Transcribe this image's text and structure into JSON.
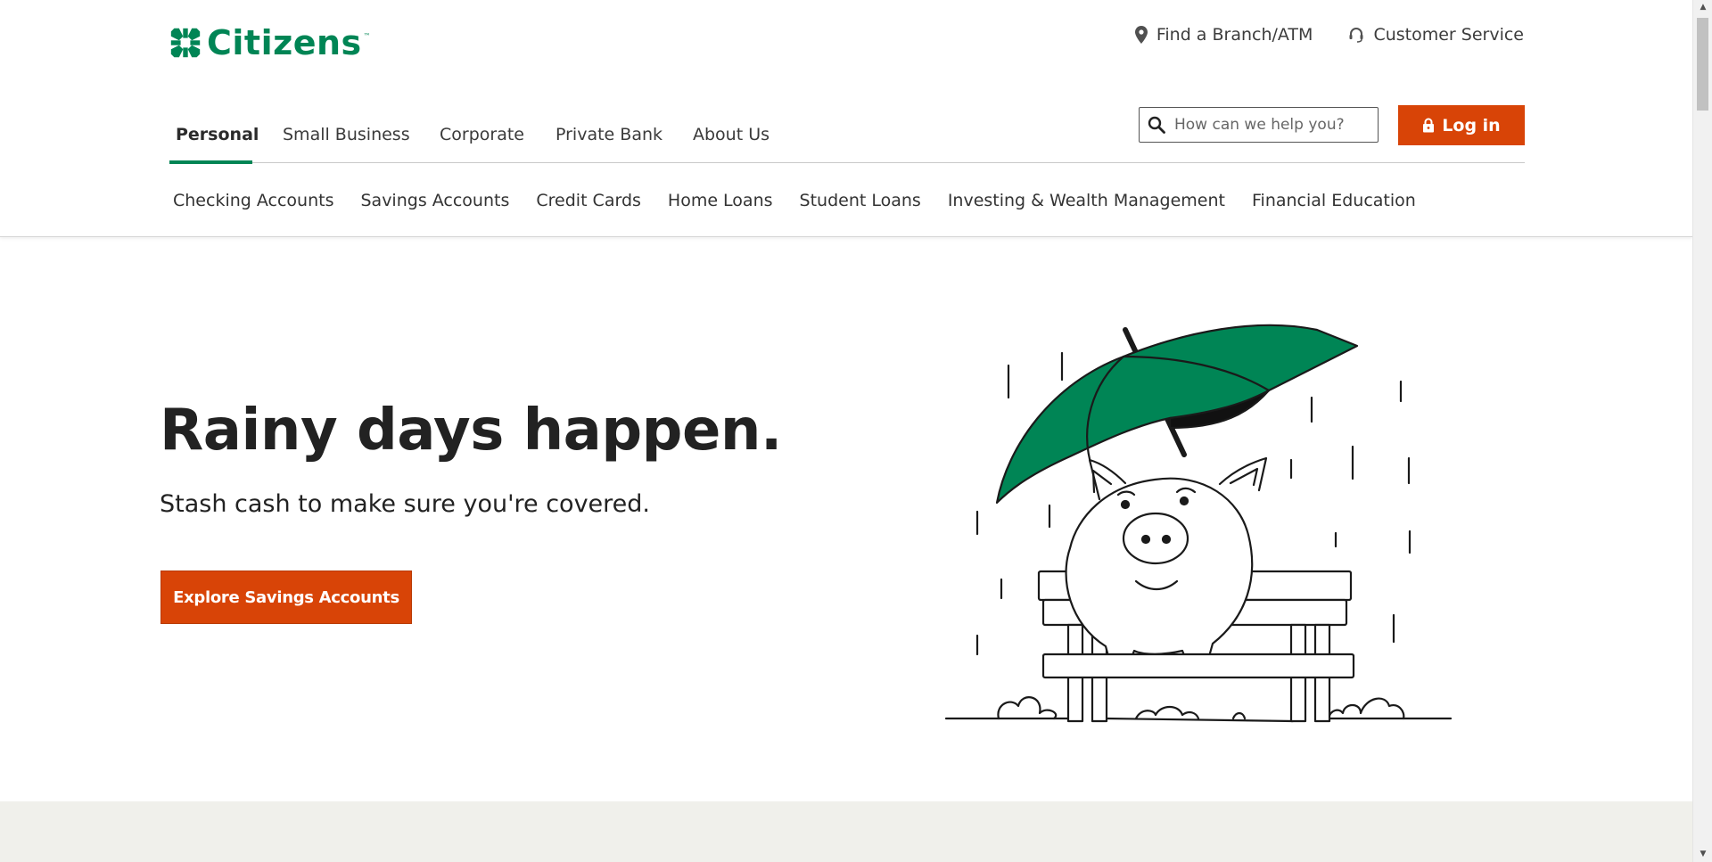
{
  "brand": {
    "name": "Citizens",
    "trademark": "™",
    "primary_color": "#008555",
    "accent_color": "#d84407"
  },
  "utility_nav": {
    "branch": {
      "label": "Find a Branch/ATM",
      "icon": "location-pin-icon"
    },
    "service": {
      "label": "Customer Service",
      "icon": "headset-icon"
    }
  },
  "main_nav": {
    "active": "Personal",
    "items": [
      "Personal",
      "Small Business",
      "Corporate",
      "Private Bank",
      "About Us"
    ]
  },
  "search": {
    "placeholder": "How can we help you?",
    "value": "",
    "icon": "search-icon"
  },
  "login": {
    "label": "Log in",
    "icon": "lock-icon"
  },
  "sub_nav": {
    "items": [
      "Checking Accounts",
      "Savings Accounts",
      "Credit Cards",
      "Home Loans",
      "Student Loans",
      "Investing & Wealth Management",
      "Financial Education"
    ]
  },
  "hero": {
    "title": "Rainy days happen.",
    "subtitle": "Stash cash to make sure you're covered.",
    "cta": "Explore Savings Accounts",
    "illustration": "piggy-bank-umbrella-bench-illustration"
  }
}
